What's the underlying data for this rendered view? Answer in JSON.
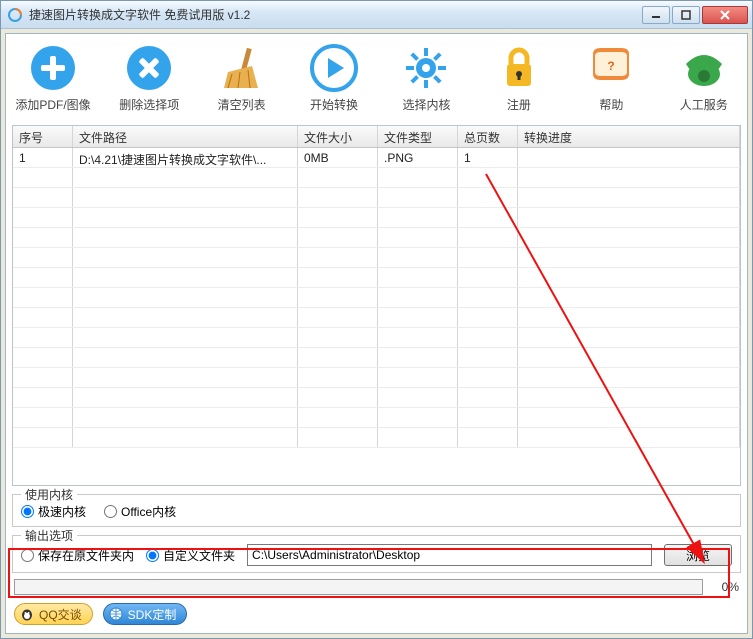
{
  "title": "捷速图片转换成文字软件 免费试用版 v1.2",
  "toolbar": {
    "add": "添加PDF/图像",
    "remove": "删除选择项",
    "clear": "清空列表",
    "start": "开始转换",
    "engine": "选择内核",
    "register": "注册",
    "help": "帮助",
    "service": "人工服务"
  },
  "columns": {
    "c0": "序号",
    "c1": "文件路径",
    "c2": "文件大小",
    "c3": "文件类型",
    "c4": "总页数",
    "c5": "转换进度"
  },
  "row": {
    "c0": "1",
    "c1": "D:\\4.21\\捷速图片转换成文字软件\\...",
    "c2": "0MB",
    "c3": ".PNG",
    "c4": "1",
    "c5": ""
  },
  "engine": {
    "title": "使用内核",
    "opt1": "极速内核",
    "opt2": "Office内核"
  },
  "output": {
    "title": "输出选项",
    "opt1": "保存在原文件夹内",
    "opt2": "自定义文件夹",
    "path": "C:\\Users\\Administrator\\Desktop",
    "browse": "浏览"
  },
  "progress": "0%",
  "bottom": {
    "qq": "QQ交谈",
    "sdk": "SDK定制"
  }
}
